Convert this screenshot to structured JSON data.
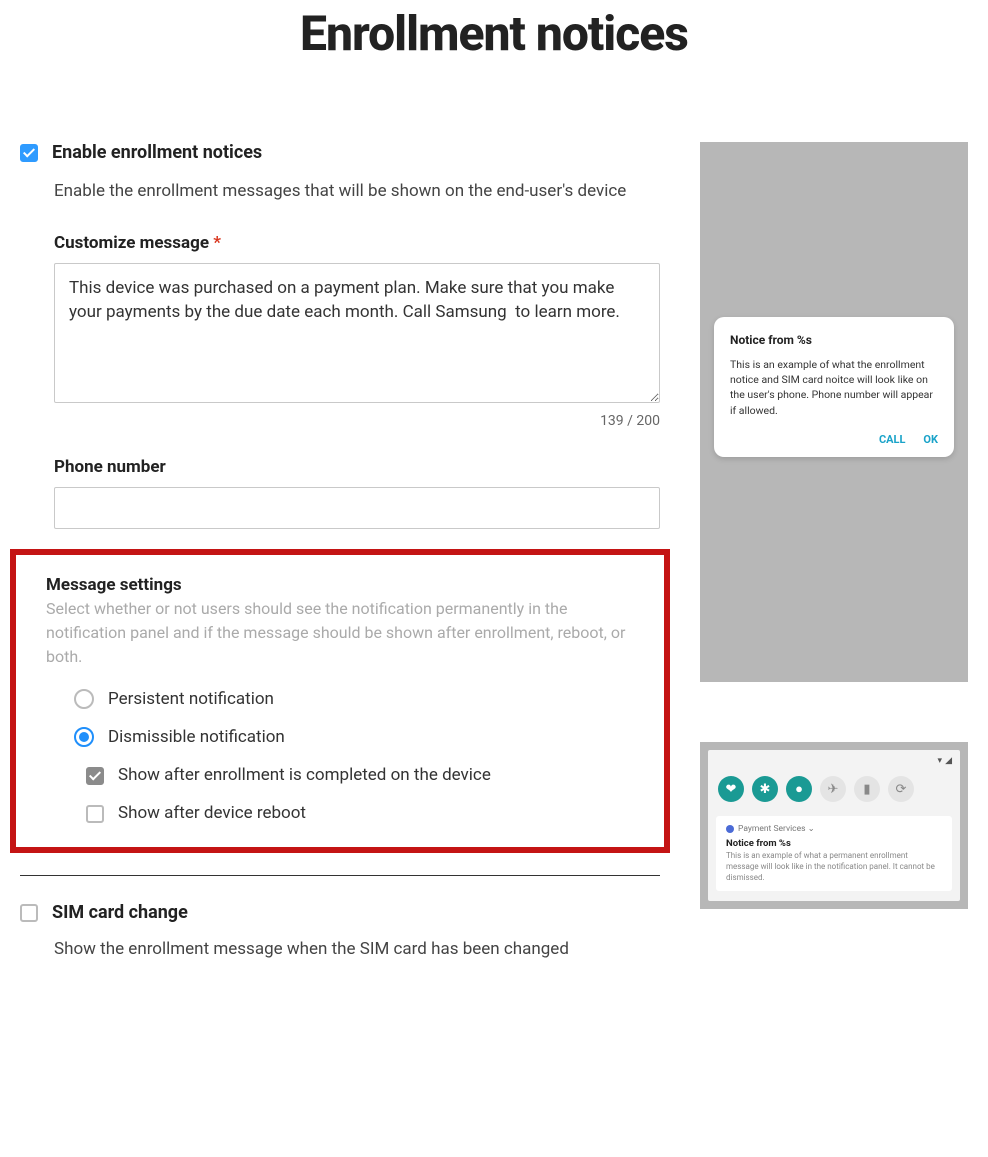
{
  "page_title": "Enrollment notices",
  "enable": {
    "checked": true,
    "label": "Enable enrollment notices",
    "desc": "Enable the enrollment messages that will be shown on the end-user's device"
  },
  "customize": {
    "label": "Customize message",
    "required_mark": "*",
    "value": "This device was purchased on a payment plan. Make sure that you make your payments by the due date each month. Call Samsung  to learn more.",
    "counter": "139 / 200"
  },
  "phone": {
    "label": "Phone number",
    "value": ""
  },
  "msg_settings": {
    "heading": "Message settings",
    "sub": "Select whether or not users should see the notification permanently in the notification panel and if the message should be shown after enrollment, reboot, or both.",
    "radio_persistent": "Persistent notification",
    "radio_dismissible": "Dismissible notification",
    "selected": "dismissible",
    "show_after_enroll": {
      "checked": true,
      "label": "Show after enrollment is completed on the device"
    },
    "show_after_reboot": {
      "checked": false,
      "label": "Show after device reboot"
    }
  },
  "sim": {
    "checked": false,
    "label": "SIM card change",
    "desc": "Show the enrollment message when the SIM card has been changed"
  },
  "preview_dialog": {
    "title": "Notice from %s",
    "body": "This is an example of what the enrollment notice and SIM card noitce will look like on the user's phone. Phone number will appear if allowed.",
    "call": "CALL",
    "ok": "OK"
  },
  "preview_notif": {
    "app": "Payment Services ⌄",
    "title": "Notice from %s",
    "body": "This is an example of what a permanent enrollment message will look like in the notification panel. It cannot be dismissed."
  },
  "qs_icons": [
    "wifi",
    "bluetooth",
    "sound",
    "airplane",
    "flashlight",
    "rotate"
  ]
}
